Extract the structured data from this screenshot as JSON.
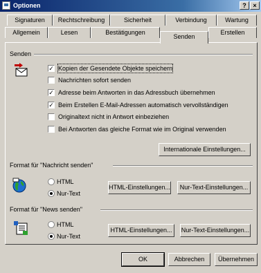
{
  "window": {
    "title": "Optionen",
    "help_glyph": "?",
    "close_glyph": "×"
  },
  "tabs_row1": [
    "Signaturen",
    "Rechtschreibung",
    "Sicherheit",
    "Verbindung",
    "Wartung"
  ],
  "tabs_row2": [
    "Allgemein",
    "Lesen",
    "Bestätigungen",
    "Senden",
    "Erstellen"
  ],
  "active_tab": "Senden",
  "sections": {
    "senden": {
      "title": "Senden",
      "checkboxes": [
        {
          "label": "Kopien der Gesendete Objekte speichern",
          "checked": true,
          "focused": true
        },
        {
          "label": "Nachrichten sofort senden",
          "checked": false
        },
        {
          "label": "Adresse beim Antworten in das Adressbuch übernehmen",
          "checked": true
        },
        {
          "label": "Beim Erstellen E-Mail-Adressen automatisch vervollständigen",
          "checked": true
        },
        {
          "label": "Originaltext nicht in Antwort einbeziehen",
          "checked": false
        },
        {
          "label": "Bei Antworten das gleiche Format wie im Original verwenden",
          "checked": false
        }
      ],
      "intl_button": "Internationale Einstellungen..."
    },
    "format_mail": {
      "title": "Format für \"Nachricht senden\"",
      "radio_html": "HTML",
      "radio_text": "Nur-Text",
      "selected": "Nur-Text",
      "html_button": "HTML-Einstellungen...",
      "text_button": "Nur-Text-Einstellungen..."
    },
    "format_news": {
      "title": "Format für \"News senden\"",
      "radio_html": "HTML",
      "radio_text": "Nur-Text",
      "selected": "Nur-Text",
      "html_button": "HTML-Einstellungen...",
      "text_button": "Nur-Text-Einstellungen..."
    }
  },
  "footer": {
    "ok": "OK",
    "cancel": "Abbrechen",
    "apply": "Übernehmen"
  }
}
